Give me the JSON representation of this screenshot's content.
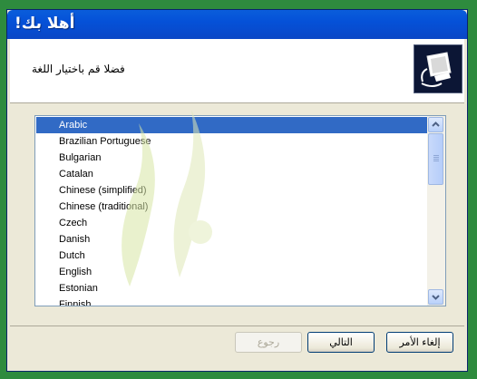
{
  "window": {
    "title": "أهلا بك!"
  },
  "header": {
    "instruction": "فضلا قم باختيار اللغة",
    "icon": "computer-setup-icon"
  },
  "language_list": {
    "selected": "Arabic",
    "items": [
      "Arabic",
      "Brazilian Portuguese",
      "Bulgarian",
      "Catalan",
      "Chinese (simplified)",
      "Chinese (traditional)",
      "Czech",
      "Danish",
      "Dutch",
      "English",
      "Estonian",
      "Finnish"
    ]
  },
  "buttons": {
    "back": "رجوع",
    "next": "التالي",
    "cancel": "إلغاء الأمر"
  },
  "colors": {
    "title_bar": "#0a5ddb",
    "selection": "#316ac5",
    "frame": "#2e8b3e"
  }
}
